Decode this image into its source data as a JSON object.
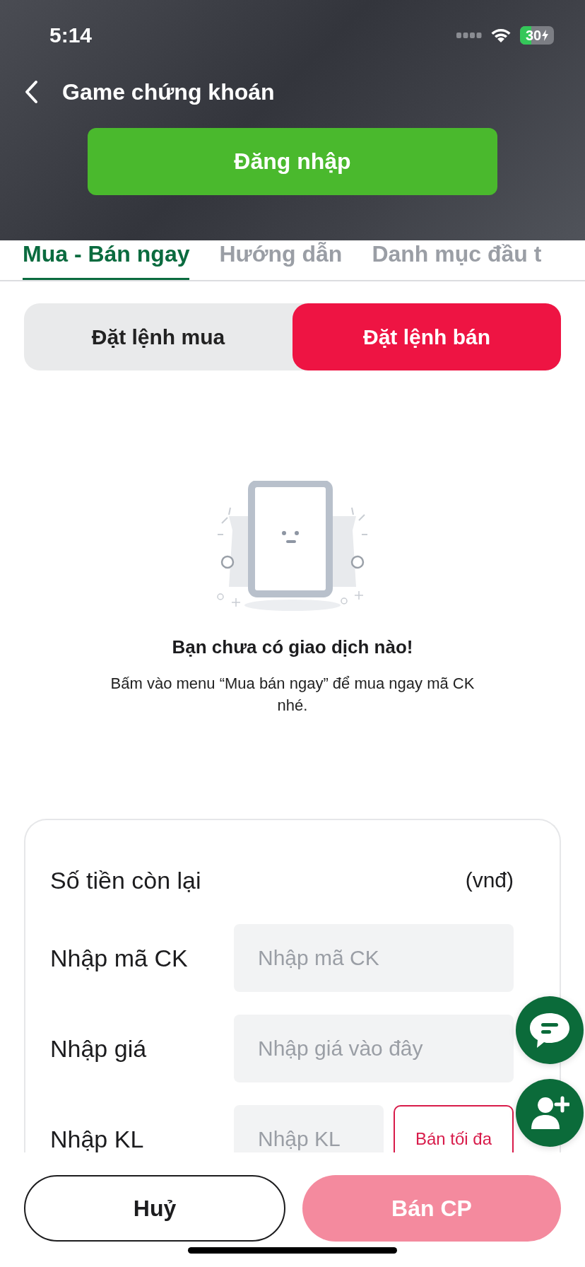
{
  "status_bar": {
    "time": "5:14",
    "battery": "30"
  },
  "header": {
    "title": "Game chứng khoán",
    "login_button": "Đăng nhập"
  },
  "tabs": [
    {
      "label": "Mua - Bán ngay",
      "selected": true
    },
    {
      "label": "Hướng dẫn",
      "selected": false
    },
    {
      "label": "Danh mục đầu t",
      "selected": false
    }
  ],
  "order_types": [
    {
      "label": "Đặt lệnh mua",
      "selected": false
    },
    {
      "label": "Đặt lệnh bán",
      "selected": true
    }
  ],
  "empty_state": {
    "title": "Bạn chưa có giao dịch nào!",
    "message": "Bấm vào menu “Mua bán ngay” để mua ngay mã CK nhé."
  },
  "form": {
    "balance_label": "Số tiền còn lại",
    "unit": "(vnđ)",
    "rows": [
      {
        "label": "Nhập mã CK",
        "placeholder": "Nhập mã CK"
      },
      {
        "label": "Nhập giá",
        "placeholder": "Nhập giá vào đây"
      },
      {
        "label": "Nhập KL",
        "placeholder": "Nhập KL",
        "action": "Bán tối đa"
      }
    ]
  },
  "buttons": [
    {
      "label": "Huỷ",
      "kind": "outline",
      "disabled": false
    },
    {
      "label": "Bán CP",
      "kind": "primary",
      "disabled": true
    }
  ]
}
